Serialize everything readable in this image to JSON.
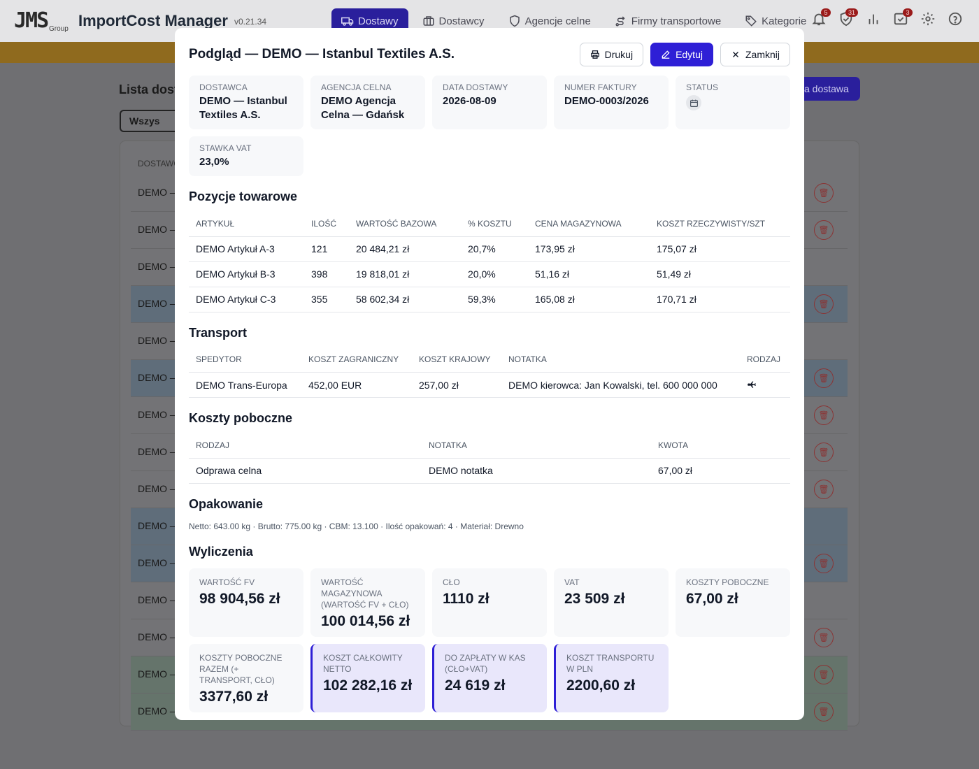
{
  "app": {
    "logo": "JMS",
    "logo_sub": "Group",
    "title": "ImportCost Manager",
    "version": "v0.21.34",
    "nav": [
      {
        "label": "Dostawy",
        "active": true
      },
      {
        "label": "Dostawcy"
      },
      {
        "label": "Agencje celne"
      },
      {
        "label": "Firmy transportowe"
      },
      {
        "label": "Kategorie"
      }
    ],
    "badges": {
      "notifications": "5",
      "shield": "31",
      "tasks": "3"
    }
  },
  "background": {
    "list_title": "Lista dost",
    "filter_label": "Wszys",
    "new_button": "a dostawa",
    "col_header": "DOSTAWC",
    "row_text": "DEMO —"
  },
  "modal": {
    "title": "Podgląd — DEMO — Istanbul Textiles A.S.",
    "buttons": {
      "print": "Drukuj",
      "edit": "Edytuj",
      "close": "Zamknij"
    },
    "info": {
      "supplier": {
        "label": "Dostawca",
        "value": "DEMO — Istanbul Textiles A.S."
      },
      "agency": {
        "label": "Agencja celna",
        "value": "DEMO Agencja Celna — Gdańsk"
      },
      "date": {
        "label": "Data dostawy",
        "value": "2026-08-09"
      },
      "invoice": {
        "label": "Numer faktury",
        "value": "DEMO-0003/2026"
      },
      "status": {
        "label": "Status",
        "icon": "calendar-icon"
      },
      "vat": {
        "label": "Stawka VAT",
        "value": "23,0%"
      }
    },
    "items": {
      "title": "Pozycje towarowe",
      "headers": [
        "Artykuł",
        "Ilość",
        "Wartość bazowa",
        "% kosztu",
        "Cena magazynowa",
        "Koszt rzeczywisty/szt"
      ],
      "rows": [
        [
          "DEMO Artykuł A-3",
          "121",
          "20 484,21 zł",
          "20,7%",
          "173,95 zł",
          "175,07 zł"
        ],
        [
          "DEMO Artykuł B-3",
          "398",
          "19 818,01 zł",
          "20,0%",
          "51,16 zł",
          "51,49 zł"
        ],
        [
          "DEMO Artykuł C-3",
          "355",
          "58 602,34 zł",
          "59,3%",
          "165,08 zł",
          "170,71 zł"
        ]
      ]
    },
    "transport": {
      "title": "Transport",
      "headers": [
        "Spedytor",
        "Koszt zagraniczny",
        "Koszt krajowy",
        "Notatka",
        "Rodzaj"
      ],
      "rows": [
        {
          "forwarder": "DEMO Trans-Europa",
          "foreign": "452,00 EUR",
          "domestic": "257,00 zł",
          "note": "DEMO kierowca: Jan Kowalski, tel. 600 000 000",
          "type_icon": "plane-icon"
        }
      ]
    },
    "side_costs": {
      "title": "Koszty poboczne",
      "headers": [
        "Rodzaj",
        "Notatka",
        "Kwota"
      ],
      "rows": [
        [
          "Odprawa celna",
          "DEMO notatka",
          "67,00 zł"
        ]
      ]
    },
    "packaging": {
      "title": "Opakowanie",
      "line": "Netto: 643.00 kg · Brutto: 775.00 kg · CBM: 13.100 · Ilość opakowań: 4 · Materiał: Drewno"
    },
    "calc": {
      "title": "Wyliczenia",
      "cards": [
        {
          "label": "Wartość FV",
          "value": "98 904,56 zł",
          "highlight": false
        },
        {
          "label": "Wartość magazynowa (wartość FV + cło)",
          "value": "100 014,56 zł",
          "highlight": false
        },
        {
          "label": "Cło",
          "value": "1110 zł",
          "highlight": false
        },
        {
          "label": "VAT",
          "value": "23 509 zł",
          "highlight": false
        },
        {
          "label": "Koszty poboczne",
          "value": "67,00 zł",
          "highlight": false
        },
        {
          "label": "Koszty poboczne razem (+ transport, cło)",
          "value": "3377,60 zł",
          "highlight": false
        },
        {
          "label": "Koszt całkowity netto",
          "value": "102 282,16 zł",
          "highlight": true
        },
        {
          "label": "Do zapłaty w KAS (cło+VAT)",
          "value": "24 619 zł",
          "highlight": true
        },
        {
          "label": "Koszt transportu w PLN",
          "value": "2200,60 zł",
          "highlight": true
        }
      ]
    }
  }
}
